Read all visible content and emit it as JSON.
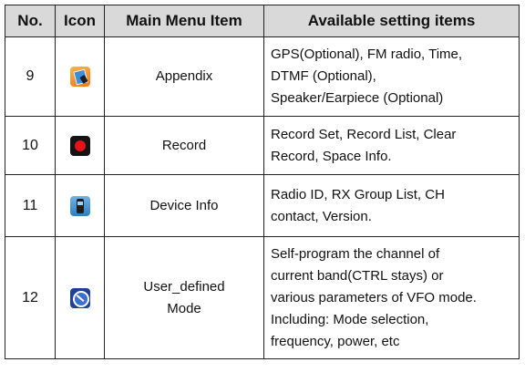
{
  "table": {
    "headers": {
      "no": "No.",
      "icon": "Icon",
      "main_menu_item": "Main Menu Item",
      "available_setting_items": "Available setting items"
    },
    "rows": [
      {
        "no": "9",
        "icon": "appendix-icon",
        "menu": "Appendix",
        "settings": [
          "GPS(Optional), FM radio, Time,",
          "DTMF (Optional),",
          "Speaker/Earpiece (Optional)"
        ]
      },
      {
        "no": "10",
        "icon": "record-icon",
        "menu": "Record",
        "settings": [
          "Record Set, Record List, Clear",
          "Record, Space Info."
        ]
      },
      {
        "no": "11",
        "icon": "device-info-icon",
        "menu": "Device Info",
        "settings": [
          "Radio ID, RX Group List, CH",
          "contact, Version."
        ]
      },
      {
        "no": "12",
        "icon": "user-defined-mode-icon",
        "menu_lines": [
          "User_defined",
          "Mode"
        ],
        "settings": [
          "Self-program the channel of",
          "current band(CTRL stays) or",
          "various parameters of VFO mode.",
          "Including: Mode selection,",
          "frequency, power, etc"
        ]
      }
    ]
  }
}
